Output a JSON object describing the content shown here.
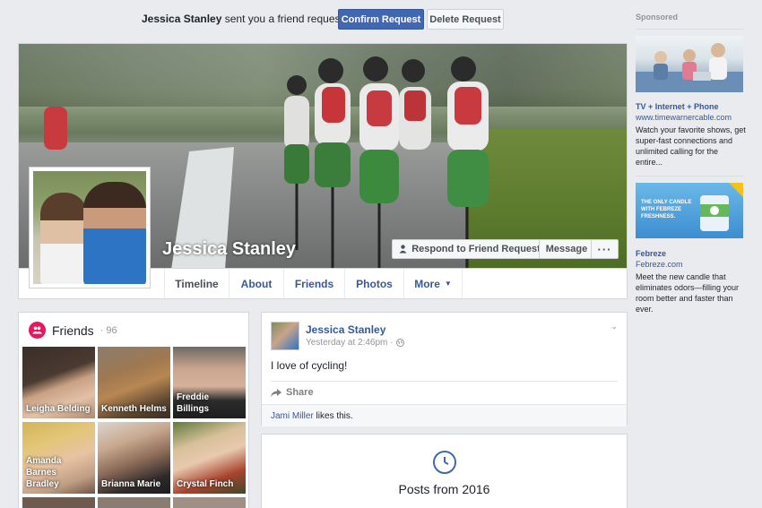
{
  "friend_request": {
    "name": "Jessica Stanley",
    "text": " sent you a friend request",
    "confirm_label": "Confirm Request",
    "delete_label": "Delete Request"
  },
  "profile": {
    "name": "Jessica Stanley",
    "respond_label": "Respond to Friend Request",
    "message_label": "Message",
    "more_label": "···"
  },
  "nav": {
    "tabs": [
      "Timeline",
      "About",
      "Friends",
      "Photos",
      "More"
    ]
  },
  "friends": {
    "title": "Friends",
    "count": "· 96",
    "items": [
      {
        "name": "Leigha Belding"
      },
      {
        "name": "Kenneth Helms"
      },
      {
        "name": "Freddie Billings"
      },
      {
        "name": "Amanda Barnes Bradley"
      },
      {
        "name": "Brianna Marie"
      },
      {
        "name": "Crystal Finch"
      }
    ]
  },
  "post": {
    "author": "Jessica Stanley",
    "time": "Yesterday at 2:46pm ·",
    "text": "I love of cycling!",
    "share_label": "Share",
    "liker": "Jami Miller",
    "likes_suffix": " likes this."
  },
  "year_section": {
    "title": "Posts from 2016"
  },
  "sponsored": {
    "title": "Sponsored",
    "ads": [
      {
        "title": "TV + Internet + Phone",
        "link": "www.timewarnercable.com",
        "description": "Watch your favorite shows, get super-fast connections and unlimited calling for the entire..."
      },
      {
        "title": "Febreze",
        "link": "Febreze.com",
        "description": "Meet the new candle that eliminates odors—filling your room better and faster than ever.",
        "image_text": "THE ONLY CANDLE WITH FEBREZE FRESHNESS."
      }
    ]
  },
  "colors": {
    "brand_blue": "#4267b2",
    "link_blue": "#365899",
    "friends_pink": "#e7155e",
    "background": "#e9ebee"
  }
}
